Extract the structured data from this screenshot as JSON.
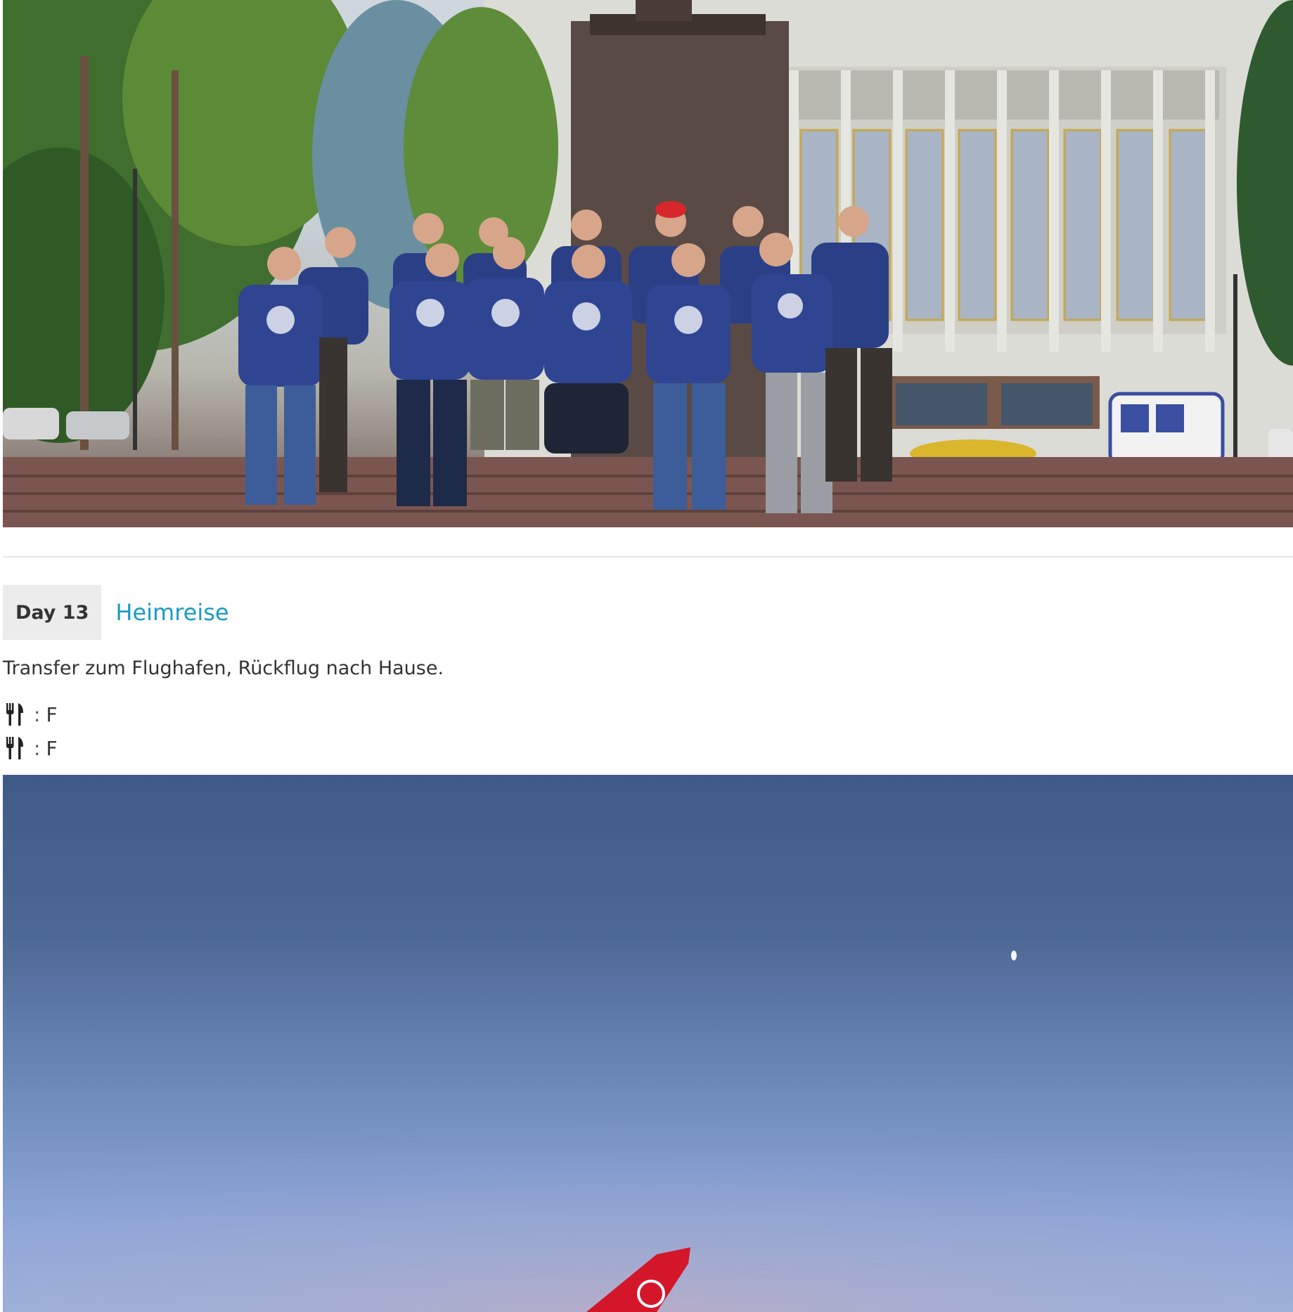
{
  "day": {
    "badge": "Day 13",
    "title": "Heimreise",
    "description": "Transfer zum Flughafen, Rückflug nach Hause."
  },
  "meals": [
    {
      "icon": "fork-knife-icon",
      "separator": ":",
      "value": "F"
    },
    {
      "icon": "fork-knife-icon",
      "separator": ":",
      "value": "F"
    }
  ],
  "photos": {
    "top": "group-photo",
    "bottom": "airplane-tail-photo"
  },
  "colors": {
    "title_accent": "#1a9bc4",
    "badge_bg": "#ececec",
    "divider": "#e6e6e6",
    "shirt_blue": "#2b3f86",
    "tail_red": "#d4162a"
  }
}
